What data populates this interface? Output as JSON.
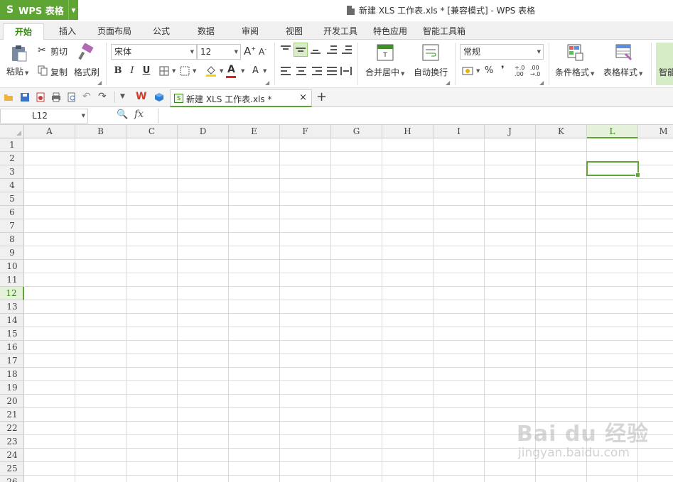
{
  "app": {
    "menu_label": "WPS 表格",
    "window_title": "新建 XLS 工作表.xls * [兼容模式] - WPS 表格"
  },
  "tabs": [
    {
      "label": "开始",
      "active": true
    },
    {
      "label": "插入"
    },
    {
      "label": "页面布局"
    },
    {
      "label": "公式"
    },
    {
      "label": "数据"
    },
    {
      "label": "审阅"
    },
    {
      "label": "视图"
    },
    {
      "label": "开发工具"
    },
    {
      "label": "特色应用"
    },
    {
      "label": "智能工具箱"
    }
  ],
  "ribbon": {
    "paste": "粘贴",
    "cut": "剪切",
    "copy": "复制",
    "format_painter": "格式刷",
    "font_name": "宋体",
    "font_size": "12",
    "bold": "B",
    "italic": "I",
    "underline": "U",
    "merge_center": "合并居中",
    "wrap_text": "自动换行",
    "number_format": "常规",
    "percent": "%",
    "comma": "❜",
    "inc_decimal": "+.0 .00",
    "dec_decimal": ".00 →.0",
    "conditional_format": "条件格式",
    "table_style": "表格样式",
    "smart": "智能"
  },
  "doc_tab": {
    "label": "新建 XLS 工作表.xls *",
    "close": "×",
    "new_tab": "+"
  },
  "formula_bar": {
    "name_box": "L12",
    "fx": "fx",
    "formula": ""
  },
  "sheet": {
    "columns": [
      "A",
      "B",
      "C",
      "D",
      "E",
      "F",
      "G",
      "H",
      "I",
      "J",
      "K",
      "L",
      "M"
    ],
    "rows": [
      "1",
      "2",
      "3",
      "4",
      "5",
      "6",
      "7",
      "8",
      "9",
      "10",
      "11",
      "12",
      "13",
      "14",
      "15",
      "16",
      "17",
      "18",
      "19",
      "20",
      "21",
      "22",
      "23",
      "24",
      "25",
      "26"
    ],
    "active_column": "L",
    "active_row": "12"
  },
  "watermark": {
    "brand": "Bai du 经验",
    "url": "jingyan.baidu.com"
  },
  "colors": {
    "accent": "#5fa533",
    "accent_dark": "#2f8a0a",
    "grid": "#dadada",
    "header_bg": "#f0f0f0"
  }
}
